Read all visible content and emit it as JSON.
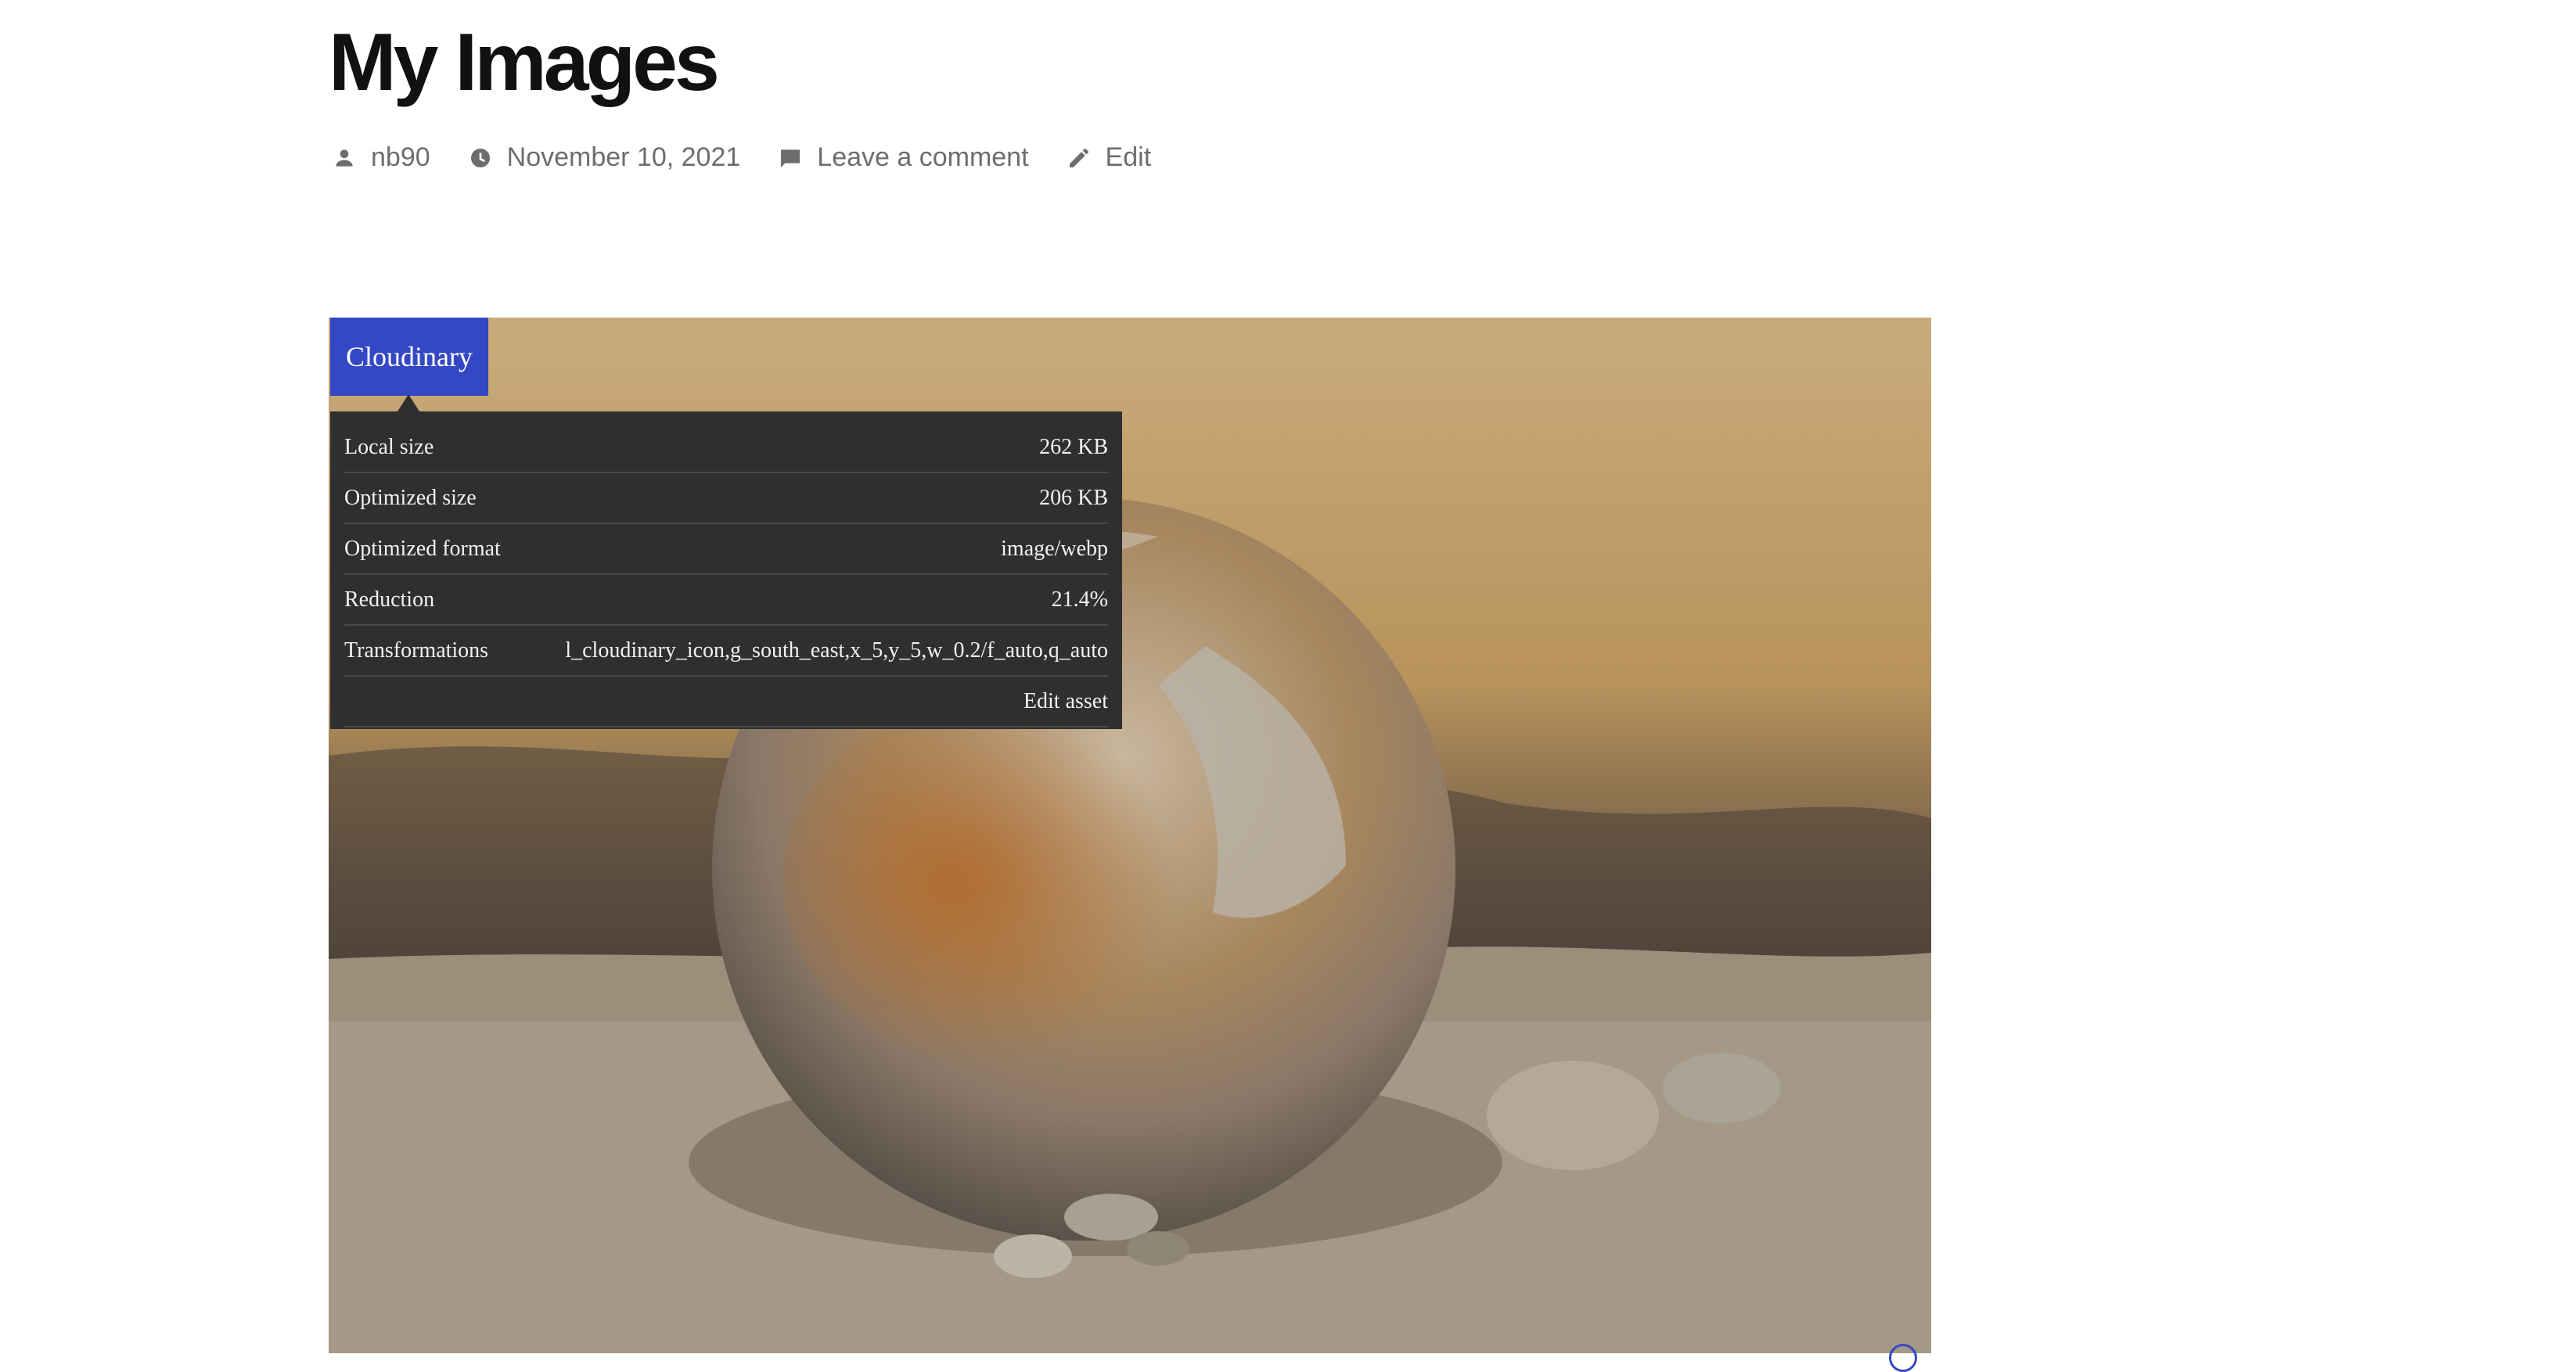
{
  "post": {
    "title": "My Images",
    "meta": {
      "author": "nb90",
      "date": "November 10, 2021",
      "comment_link": "Leave a comment",
      "edit_link": "Edit"
    }
  },
  "cloudinary": {
    "tag_label": "Cloudinary",
    "rows": [
      {
        "key": "Local size",
        "value": "262 KB"
      },
      {
        "key": "Optimized size",
        "value": "206 KB"
      },
      {
        "key": "Optimized format",
        "value": "image/webp"
      },
      {
        "key": "Reduction",
        "value": "21.4%"
      },
      {
        "key": "Transformations",
        "value": "l_cloudinary_icon,g_south_east,x_5,y_5,w_0.2/f_auto,q_auto"
      }
    ],
    "edit_asset": "Edit asset",
    "brand_color": "#3448c5"
  },
  "icons": {
    "author": "person-icon",
    "date": "clock-icon",
    "comment": "comment-icon",
    "edit": "pencil-icon"
  }
}
